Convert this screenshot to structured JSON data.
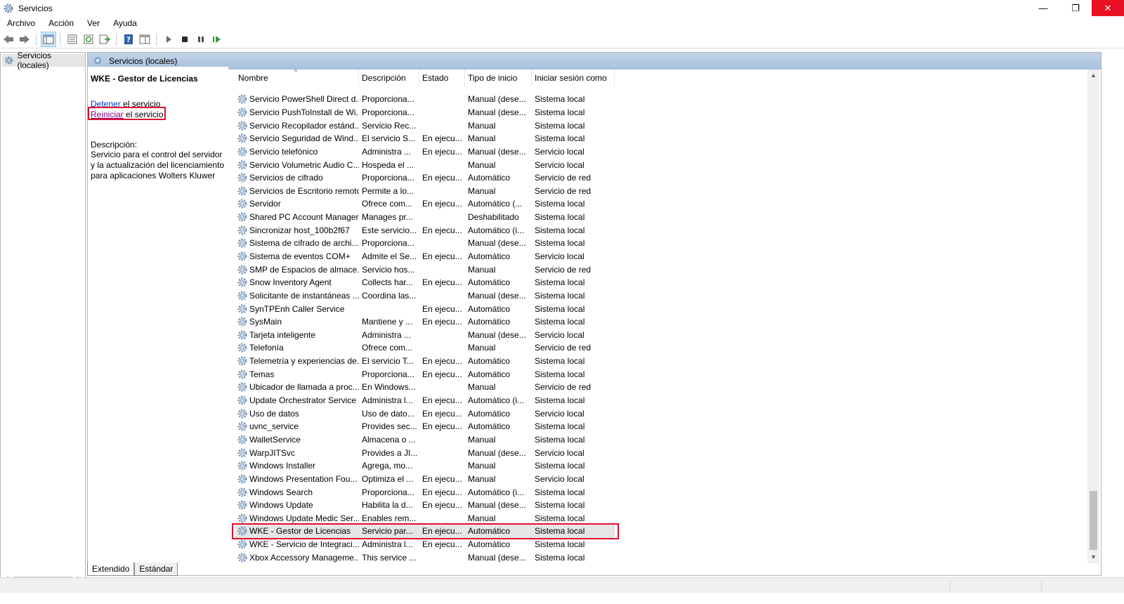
{
  "window": {
    "title": "Servicios",
    "controls": {
      "minimize": "—",
      "restore": "❐",
      "close": "✕"
    }
  },
  "menu": [
    "Archivo",
    "Acción",
    "Ver",
    "Ayuda"
  ],
  "toolbar": {
    "icons": [
      "back-arrow-icon",
      "forward-arrow-icon",
      "show-tree-icon",
      "properties-icon",
      "refresh-icon",
      "export-list-icon",
      "help-icon",
      "console-view-icon",
      "start-service-icon",
      "stop-service-icon",
      "pause-service-icon",
      "resume-service-icon"
    ]
  },
  "tree": {
    "root_label": "Servicios (locales)"
  },
  "pane": {
    "header": "Servicios (locales)"
  },
  "info": {
    "service_title": "WKE - Gestor de Licencias",
    "stop_link": "Detener",
    "stop_suffix": " el servicio",
    "restart_link": "Reiniciar",
    "restart_suffix": " el servicio",
    "description_label": "Descripción:",
    "description_text": "Servicio para el control del servidor y la actualización del licenciamiento para aplicaciones Wolters Kluwer"
  },
  "columns": [
    "Nombre",
    "Descripción",
    "Estado",
    "Tipo de inicio",
    "Iniciar sesión como"
  ],
  "services": [
    [
      "Servicio PowerShell Direct d...",
      "Proporciona...",
      "",
      "Manual (dese...",
      "Sistema local"
    ],
    [
      "Servicio PushToInstall de Wi...",
      "Proporciona...",
      "",
      "Manual (dese...",
      "Sistema local"
    ],
    [
      "Servicio Recopilador estánd...",
      "Servicio Rec...",
      "",
      "Manual",
      "Sistema local"
    ],
    [
      "Servicio Seguridad de Wind...",
      "El servicio S...",
      "En ejecu...",
      "Manual",
      "Sistema local"
    ],
    [
      "Servicio telefónico",
      "Administra ...",
      "En ejecu...",
      "Manual (dese...",
      "Servicio local"
    ],
    [
      "Servicio Volumetric Audio C...",
      "Hospeda el ...",
      "",
      "Manual",
      "Servicio local"
    ],
    [
      "Servicios de cifrado",
      "Proporciona...",
      "En ejecu...",
      "Automático",
      "Servicio de red"
    ],
    [
      "Servicios de Escritorio remoto",
      "Permite a lo...",
      "",
      "Manual",
      "Servicio de red"
    ],
    [
      "Servidor",
      "Ofrece com...",
      "En ejecu...",
      "Automático (...",
      "Sistema local"
    ],
    [
      "Shared PC Account Manager",
      "Manages pr...",
      "",
      "Deshabilitado",
      "Sistema local"
    ],
    [
      "Sincronizar host_100b2f67",
      "Este servicio...",
      "En ejecu...",
      "Automático (i...",
      "Sistema local"
    ],
    [
      "Sistema de cifrado de archi...",
      "Proporciona...",
      "",
      "Manual (dese...",
      "Sistema local"
    ],
    [
      "Sistema de eventos COM+",
      "Admite el Se...",
      "En ejecu...",
      "Automático",
      "Servicio local"
    ],
    [
      "SMP de Espacios de almace...",
      "Servicio hos...",
      "",
      "Manual",
      "Servicio de red"
    ],
    [
      "Snow Inventory Agent",
      "Collects har...",
      "En ejecu...",
      "Automático",
      "Sistema local"
    ],
    [
      "Solicitante de instantáneas ...",
      "Coordina las...",
      "",
      "Manual (dese...",
      "Sistema local"
    ],
    [
      "SynTPEnh Caller Service",
      "",
      "En ejecu...",
      "Automático",
      "Sistema local"
    ],
    [
      "SysMain",
      "Mantiene y ...",
      "En ejecu...",
      "Automático",
      "Sistema local"
    ],
    [
      "Tarjeta inteligente",
      "Administra ...",
      "",
      "Manual (dese...",
      "Servicio local"
    ],
    [
      "Telefonía",
      "Ofrece com...",
      "",
      "Manual",
      "Servicio de red"
    ],
    [
      "Telemetría y experiencias de...",
      "El servicio T...",
      "En ejecu...",
      "Automático",
      "Sistema local"
    ],
    [
      "Temas",
      "Proporciona...",
      "En ejecu...",
      "Automático",
      "Sistema local"
    ],
    [
      "Ubicador de llamada a proc...",
      "En Windows...",
      "",
      "Manual",
      "Servicio de red"
    ],
    [
      "Update Orchestrator Service",
      "Administra l...",
      "En ejecu...",
      "Automático (i...",
      "Sistema local"
    ],
    [
      "Uso de datos",
      "Uso de dato...",
      "En ejecu...",
      "Automático",
      "Servicio local"
    ],
    [
      "uvnc_service",
      "Provides sec...",
      "En ejecu...",
      "Automático",
      "Sistema local"
    ],
    [
      "WalletService",
      "Almacena o ...",
      "",
      "Manual",
      "Sistema local"
    ],
    [
      "WarpJITSvc",
      "Provides a JI...",
      "",
      "Manual (dese...",
      "Servicio local"
    ],
    [
      "Windows Installer",
      "Agrega, mo...",
      "",
      "Manual",
      "Sistema local"
    ],
    [
      "Windows Presentation Fou...",
      "Optimiza el ...",
      "En ejecu...",
      "Manual",
      "Servicio local"
    ],
    [
      "Windows Search",
      "Proporciona...",
      "En ejecu...",
      "Automático (i...",
      "Sistema local"
    ],
    [
      "Windows Update",
      "Habilita la d...",
      "En ejecu...",
      "Manual (dese...",
      "Sistema local"
    ],
    [
      "Windows Update Medic Ser...",
      "Enables rem...",
      "",
      "Manual",
      "Sistema local"
    ],
    [
      "WKE - Gestor de Licencias",
      "Servicio par...",
      "En ejecu...",
      "Automático",
      "Sistema local"
    ],
    [
      "WKE - Servicio de Integraci...",
      "Administra l...",
      "En ejecu...",
      "Automático",
      "Sistema local"
    ],
    [
      "Xbox Accessory Manageme...",
      "This service ...",
      "",
      "Manual (dese...",
      "Sistema local"
    ]
  ],
  "selected_service": "WKE - Gestor de Licencias",
  "tabs": [
    "Extendido",
    "Estándar"
  ],
  "colors": {
    "highlight_red": "#e0102f",
    "header_blue": "#b4c8e0",
    "link_blue": "#0033cc",
    "visited_link": "#800080",
    "close_red": "#e81123"
  }
}
